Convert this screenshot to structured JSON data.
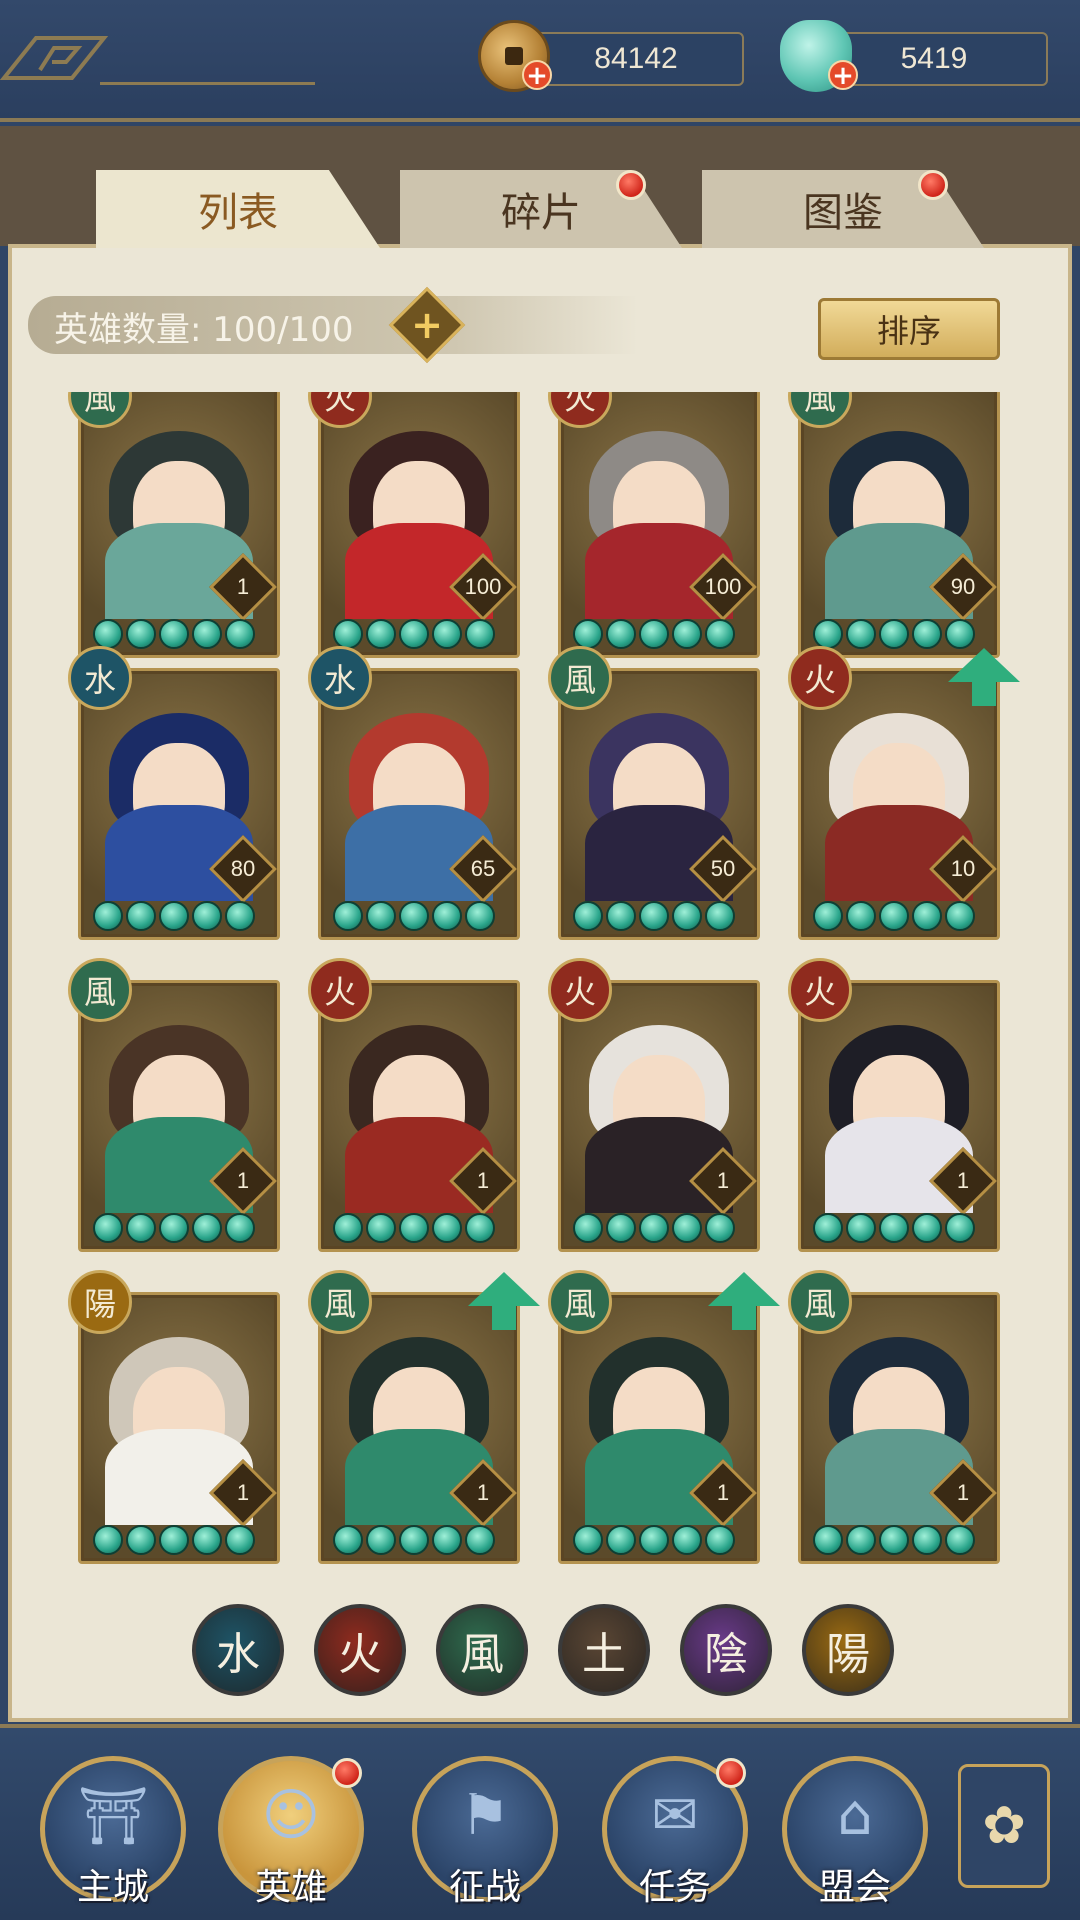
{
  "currency": {
    "coins": "84142",
    "jade": "5419"
  },
  "tabs": [
    {
      "label": "列表",
      "active": true,
      "badge": false
    },
    {
      "label": "碎片",
      "active": false,
      "badge": true
    },
    {
      "label": "图鉴",
      "active": false,
      "badge": true
    }
  ],
  "hero_count_label": "英雄数量: 100/100",
  "sort_label": "排序",
  "heroes": [
    {
      "element": "風",
      "element_color": "#2f6b4e",
      "level": "1",
      "upgrade": false,
      "hair": "#2d3836",
      "outfit": "#6aa79a"
    },
    {
      "element": "火",
      "element_color": "#8f2b1e",
      "level": "100",
      "upgrade": false,
      "hair": "#3a2220",
      "outfit": "#c3272a"
    },
    {
      "element": "火",
      "element_color": "#8f2b1e",
      "level": "100",
      "upgrade": false,
      "hair": "#8e8a86",
      "outfit": "#a5262c"
    },
    {
      "element": "風",
      "element_color": "#2f6b4e",
      "level": "90",
      "upgrade": false,
      "hair": "#1d2b3a",
      "outfit": "#5f9a8e"
    },
    {
      "element": "水",
      "element_color": "#1e5466",
      "level": "80",
      "upgrade": false,
      "hair": "#1b2c66",
      "outfit": "#2d4fa0"
    },
    {
      "element": "水",
      "element_color": "#1e5466",
      "level": "65",
      "upgrade": false,
      "hair": "#b33a2e",
      "outfit": "#3d6fa6"
    },
    {
      "element": "風",
      "element_color": "#2f6b4e",
      "level": "50",
      "upgrade": false,
      "hair": "#3b3460",
      "outfit": "#2a2440"
    },
    {
      "element": "火",
      "element_color": "#8f2b1e",
      "level": "10",
      "upgrade": true,
      "hair": "#e8e0d6",
      "outfit": "#8b2a24"
    },
    {
      "element": "風",
      "element_color": "#2f6b4e",
      "level": "1",
      "upgrade": false,
      "hair": "#4a3426",
      "outfit": "#2f8a6c"
    },
    {
      "element": "火",
      "element_color": "#8f2b1e",
      "level": "1",
      "upgrade": false,
      "hair": "#3a2820",
      "outfit": "#9a2a22"
    },
    {
      "element": "火",
      "element_color": "#8f2b1e",
      "level": "1",
      "upgrade": false,
      "hair": "#e6e2dc",
      "outfit": "#2a2226"
    },
    {
      "element": "火",
      "element_color": "#8f2b1e",
      "level": "1",
      "upgrade": false,
      "hair": "#1e1e26",
      "outfit": "#e6e4ea"
    },
    {
      "element": "陽",
      "element_color": "#9a6a12",
      "level": "1",
      "upgrade": false,
      "hair": "#cfc7b9",
      "outfit": "#f2f0ea"
    },
    {
      "element": "風",
      "element_color": "#2f6b4e",
      "level": "1",
      "upgrade": true,
      "hair": "#22302c",
      "outfit": "#2f8a6c"
    },
    {
      "element": "風",
      "element_color": "#2f6b4e",
      "level": "1",
      "upgrade": true,
      "hair": "#22302c",
      "outfit": "#2f8a6c"
    },
    {
      "element": "風",
      "element_color": "#2f6b4e",
      "level": "1",
      "upgrade": false,
      "hair": "#1d2b3a",
      "outfit": "#5f9a8e"
    }
  ],
  "element_filters": [
    {
      "glyph": "水",
      "color": "#1e5466"
    },
    {
      "glyph": "火",
      "color": "#8f2b1e"
    },
    {
      "glyph": "風",
      "color": "#2f6b4e"
    },
    {
      "glyph": "土",
      "color": "#5a4634"
    },
    {
      "glyph": "陰",
      "color": "#6a3a8a"
    },
    {
      "glyph": "陽",
      "color": "#9a6a12"
    }
  ],
  "nav": [
    {
      "label": "主城",
      "icon": "city-gate-icon",
      "active": false,
      "badge": false
    },
    {
      "label": "英雄",
      "icon": "hero-portrait-icon",
      "active": true,
      "badge": true
    },
    {
      "label": "征战",
      "icon": "war-horn-icon",
      "active": false,
      "badge": false
    },
    {
      "label": "任务",
      "icon": "scroll-task-icon",
      "active": false,
      "badge": true
    },
    {
      "label": "盟会",
      "icon": "alliance-hall-icon",
      "active": false,
      "badge": false
    }
  ]
}
